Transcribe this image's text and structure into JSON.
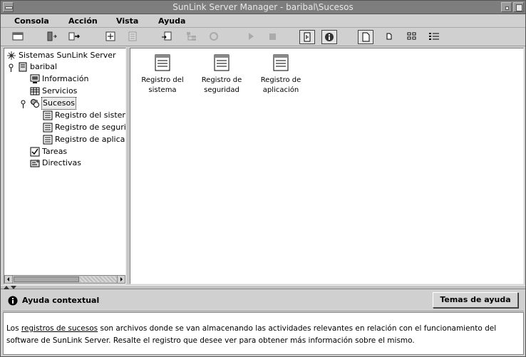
{
  "window": {
    "title": "SunLink Server Manager - baribal\\Sucesos"
  },
  "menubar": {
    "items": [
      "Consola",
      "Acción",
      "Vista",
      "Ayuda"
    ]
  },
  "tree": {
    "root": "Sistemas SunLink Server",
    "server": "baribal",
    "items": [
      {
        "label": "Información",
        "icon": "monitor-icon"
      },
      {
        "label": "Servicios",
        "icon": "services-grid-icon"
      },
      {
        "label": "Sucesos",
        "icon": "events-icon"
      },
      {
        "label": "Registro del sistema",
        "icon": "log-icon"
      },
      {
        "label": "Registro de seguridad",
        "icon": "log-icon"
      },
      {
        "label": "Registro de aplicación",
        "icon": "log-icon"
      },
      {
        "label": "Tareas",
        "icon": "tasks-icon"
      },
      {
        "label": "Directivas",
        "icon": "policies-icon"
      }
    ]
  },
  "content": {
    "items": [
      {
        "line1": "Registro del",
        "line2": "sistema"
      },
      {
        "line1": "Registro de",
        "line2": "seguridad"
      },
      {
        "line1": "Registro de",
        "line2": "aplicación"
      }
    ]
  },
  "help": {
    "title": "Ayuda contextual",
    "topics_button": "Temas de ayuda",
    "text_before": "Los ",
    "link": "registros de sucesos",
    "text_after_line1": " son archivos donde se van almacenando las actividades relevantes en relación con el funcionamiento del",
    "text_line2": "software de SunLink Server. Resalte el registro que desee ver para obtener más información sobre el mismo."
  }
}
